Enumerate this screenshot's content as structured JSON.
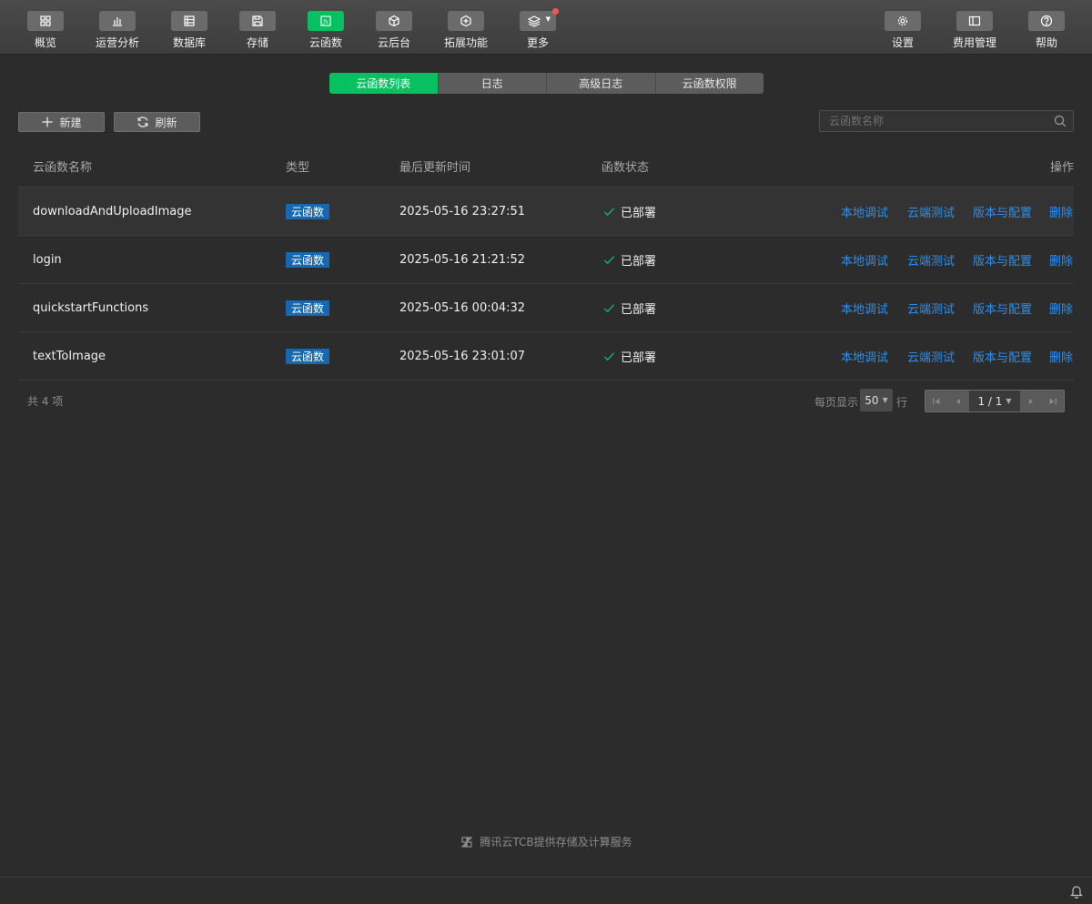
{
  "toolbar": {
    "left": [
      {
        "label": "概览",
        "icon": "overview-icon"
      },
      {
        "label": "运营分析",
        "icon": "analytics-icon"
      },
      {
        "label": "数据库",
        "icon": "database-icon"
      },
      {
        "label": "存储",
        "icon": "storage-icon"
      },
      {
        "label": "云函数",
        "icon": "function-icon",
        "active": true
      },
      {
        "label": "云后台",
        "icon": "cube-icon"
      },
      {
        "label": "拓展功能",
        "icon": "extension-icon"
      },
      {
        "label": "更多",
        "icon": "layers-icon",
        "has_notification": true
      }
    ],
    "right": [
      {
        "label": "设置",
        "icon": "gear-icon"
      },
      {
        "label": "费用管理",
        "icon": "billing-icon"
      },
      {
        "label": "帮助",
        "icon": "help-icon"
      }
    ]
  },
  "tabs": [
    "云函数列表",
    "日志",
    "高级日志",
    "云函数权限"
  ],
  "actions": {
    "new_label": "新建",
    "refresh_label": "刷新"
  },
  "search": {
    "placeholder": "云函数名称"
  },
  "table": {
    "headers": {
      "name": "云函数名称",
      "type": "类型",
      "updated": "最后更新时间",
      "status": "函数状态",
      "ops": "操作"
    },
    "rows": [
      {
        "name": "downloadAndUploadImage",
        "type": "云函数",
        "updated": "2025-05-16 23:27:51",
        "status": "已部署"
      },
      {
        "name": "login",
        "type": "云函数",
        "updated": "2025-05-16 21:21:52",
        "status": "已部署"
      },
      {
        "name": "quickstartFunctions",
        "type": "云函数",
        "updated": "2025-05-16 00:04:32",
        "status": "已部署"
      },
      {
        "name": "textToImage",
        "type": "云函数",
        "updated": "2025-05-16 23:01:07",
        "status": "已部署"
      }
    ],
    "row_actions": [
      "本地调试",
      "云端测试",
      "版本与配置",
      "删除"
    ]
  },
  "footer": {
    "total": "共 4 项",
    "per_page_label": "每页显示",
    "per_page_value": "50",
    "per_page_unit": "行",
    "page_display": "1 / 1"
  },
  "powered_by": "腾讯云TCB提供存储及计算服务",
  "colors": {
    "accent": "#07c160",
    "link": "#2b8ff0",
    "badge": "#1768b0"
  }
}
